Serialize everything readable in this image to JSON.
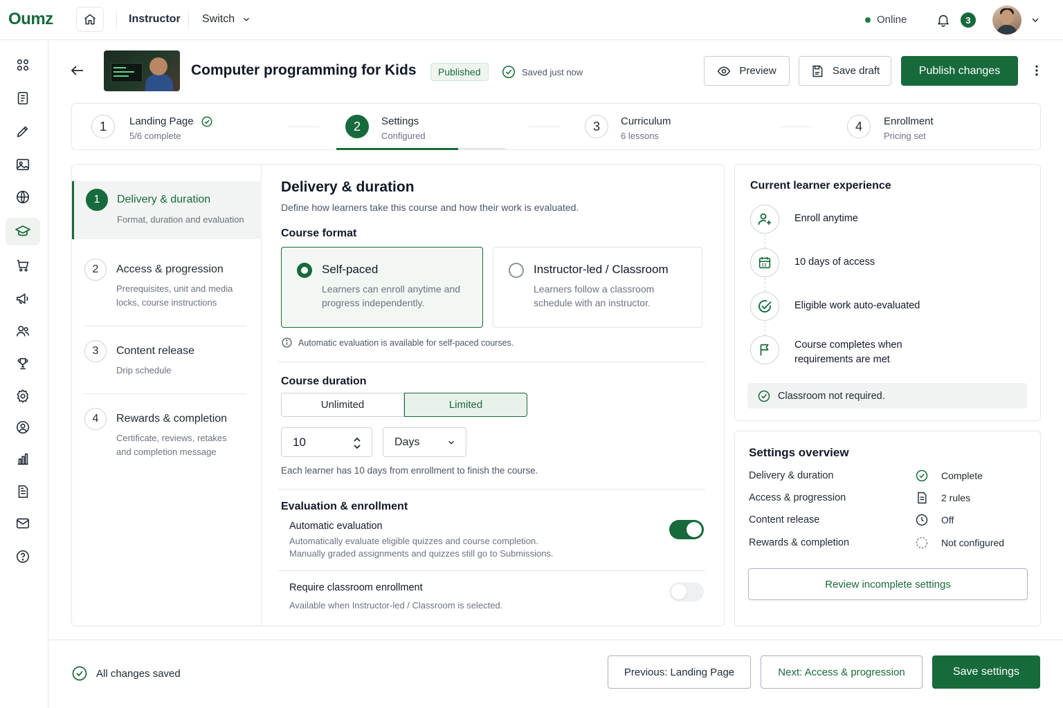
{
  "app": {
    "logo": "Oumz"
  },
  "topbar": {
    "crumb_role": "Instructor",
    "switch_label": "Switch",
    "status": "Online",
    "notification_count": "3"
  },
  "course": {
    "title": "Computer programming for Kids",
    "status_badge": "Published",
    "save_status": "Saved just now"
  },
  "actions": {
    "preview": "Preview",
    "save_draft": "Save draft",
    "publish": "Publish changes"
  },
  "steps": [
    {
      "num": "1",
      "title": "Landing Page",
      "sub": "5/6 complete"
    },
    {
      "num": "2",
      "title": "Settings",
      "sub": "Configured"
    },
    {
      "num": "3",
      "title": "Curriculum",
      "sub": "6 lessons"
    },
    {
      "num": "4",
      "title": "Enrollment",
      "sub": "Pricing set"
    }
  ],
  "sections": [
    {
      "num": "1",
      "title": "Delivery & duration",
      "desc": "Format, duration and evaluation"
    },
    {
      "num": "2",
      "title": "Access & progression",
      "desc": "Prerequisites, unit and media locks, course instructions"
    },
    {
      "num": "3",
      "title": "Content release",
      "desc": "Drip schedule"
    },
    {
      "num": "4",
      "title": "Rewards & completion",
      "desc": "Certificate, reviews, retakes and completion message"
    }
  ],
  "delivery": {
    "title": "Delivery & duration",
    "subtitle": "Define how learners take this course and how their work is evaluated.",
    "format_heading": "Course format",
    "formats": [
      {
        "title": "Self-paced",
        "desc": "Learners can enroll anytime and progress independently."
      },
      {
        "title": "Instructor-led / Classroom",
        "desc": "Learners follow a classroom schedule with an instructor."
      }
    ],
    "format_info": "Automatic evaluation is available for self-paced courses.",
    "duration_heading": "Course duration",
    "duration_options": [
      "Unlimited",
      "Limited"
    ],
    "duration_value": "10",
    "duration_unit": "Days",
    "duration_help": "Each learner has 10 days from enrollment to finish the course.",
    "eval_heading": "Evaluation & enrollment",
    "auto_eval_title": "Automatic evaluation",
    "auto_eval_desc1": "Automatically evaluate eligible quizzes and course completion.",
    "auto_eval_desc2": "Manually graded assignments and quizzes still go to Submissions.",
    "classroom_title": "Require classroom enrollment",
    "classroom_desc": "Available when Instructor-led / Classroom is selected."
  },
  "experience": {
    "title": "Current learner experience",
    "items": [
      "Enroll anytime",
      "10 days of access",
      "Eligible work auto-evaluated",
      "Course completes when",
      "requirements are met"
    ],
    "note": "Classroom not required."
  },
  "overview": {
    "title": "Settings overview",
    "rows": [
      {
        "label": "Delivery & duration",
        "status": "Complete"
      },
      {
        "label": "Access & progression",
        "status": "2 rules"
      },
      {
        "label": "Content release",
        "status": "Off"
      },
      {
        "label": "Rewards & completion",
        "status": "Not configured"
      }
    ],
    "review_button": "Review incomplete settings"
  },
  "footer": {
    "saved": "All changes saved",
    "previous": "Previous: Landing Page",
    "next": "Next: Access & progression",
    "save": "Save settings"
  },
  "colors": {
    "brand": "#176a3b",
    "border": "#e5e7eb",
    "muted_text": "#6b7280"
  }
}
